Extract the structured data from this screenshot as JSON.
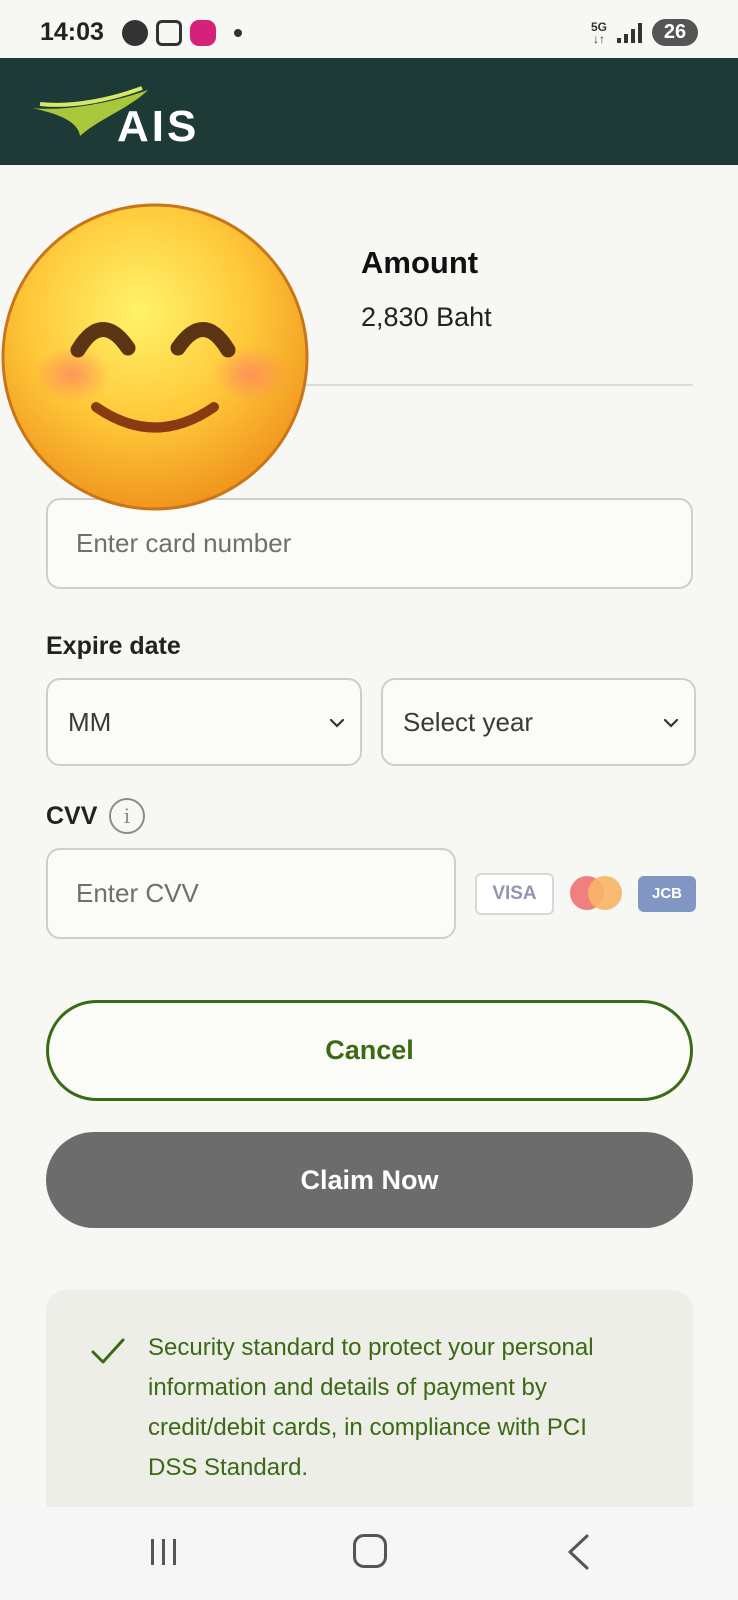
{
  "status_bar": {
    "time": "14:03",
    "network": "5G",
    "battery": "26",
    "left_icons": [
      "face-icon",
      "screen-capture-icon",
      "lazada-icon",
      "notification-dot"
    ]
  },
  "header": {
    "logo_text": "AIS",
    "colors": {
      "background": "#1d3a36",
      "logo_swoosh": "#a8c73a"
    }
  },
  "payment": {
    "amount_label": "Amount",
    "amount_value": "2,830 Baht"
  },
  "form": {
    "card_number_placeholder": "Enter card number",
    "expire_label": "Expire date",
    "month_select_value": "MM",
    "year_select_value": "Select year",
    "cvv_label": "CVV",
    "cvv_placeholder": "Enter CVV",
    "card_brands": {
      "visa": "VISA",
      "mastercard": "mastercard-logo",
      "jcb": "JCB"
    }
  },
  "actions": {
    "cancel_label": "Cancel",
    "claim_label": "Claim Now",
    "colors": {
      "accent": "#3c6a14",
      "claim_bg": "#6c6c6c"
    }
  },
  "security": {
    "text": "Security standard to protect your personal information and details of payment by credit/debit cards, in compliance with PCI DSS Standard."
  },
  "overlay": {
    "icon": "smiling-face-emoji"
  },
  "nav": {
    "icons": [
      "recents-icon",
      "home-icon",
      "back-icon"
    ]
  }
}
